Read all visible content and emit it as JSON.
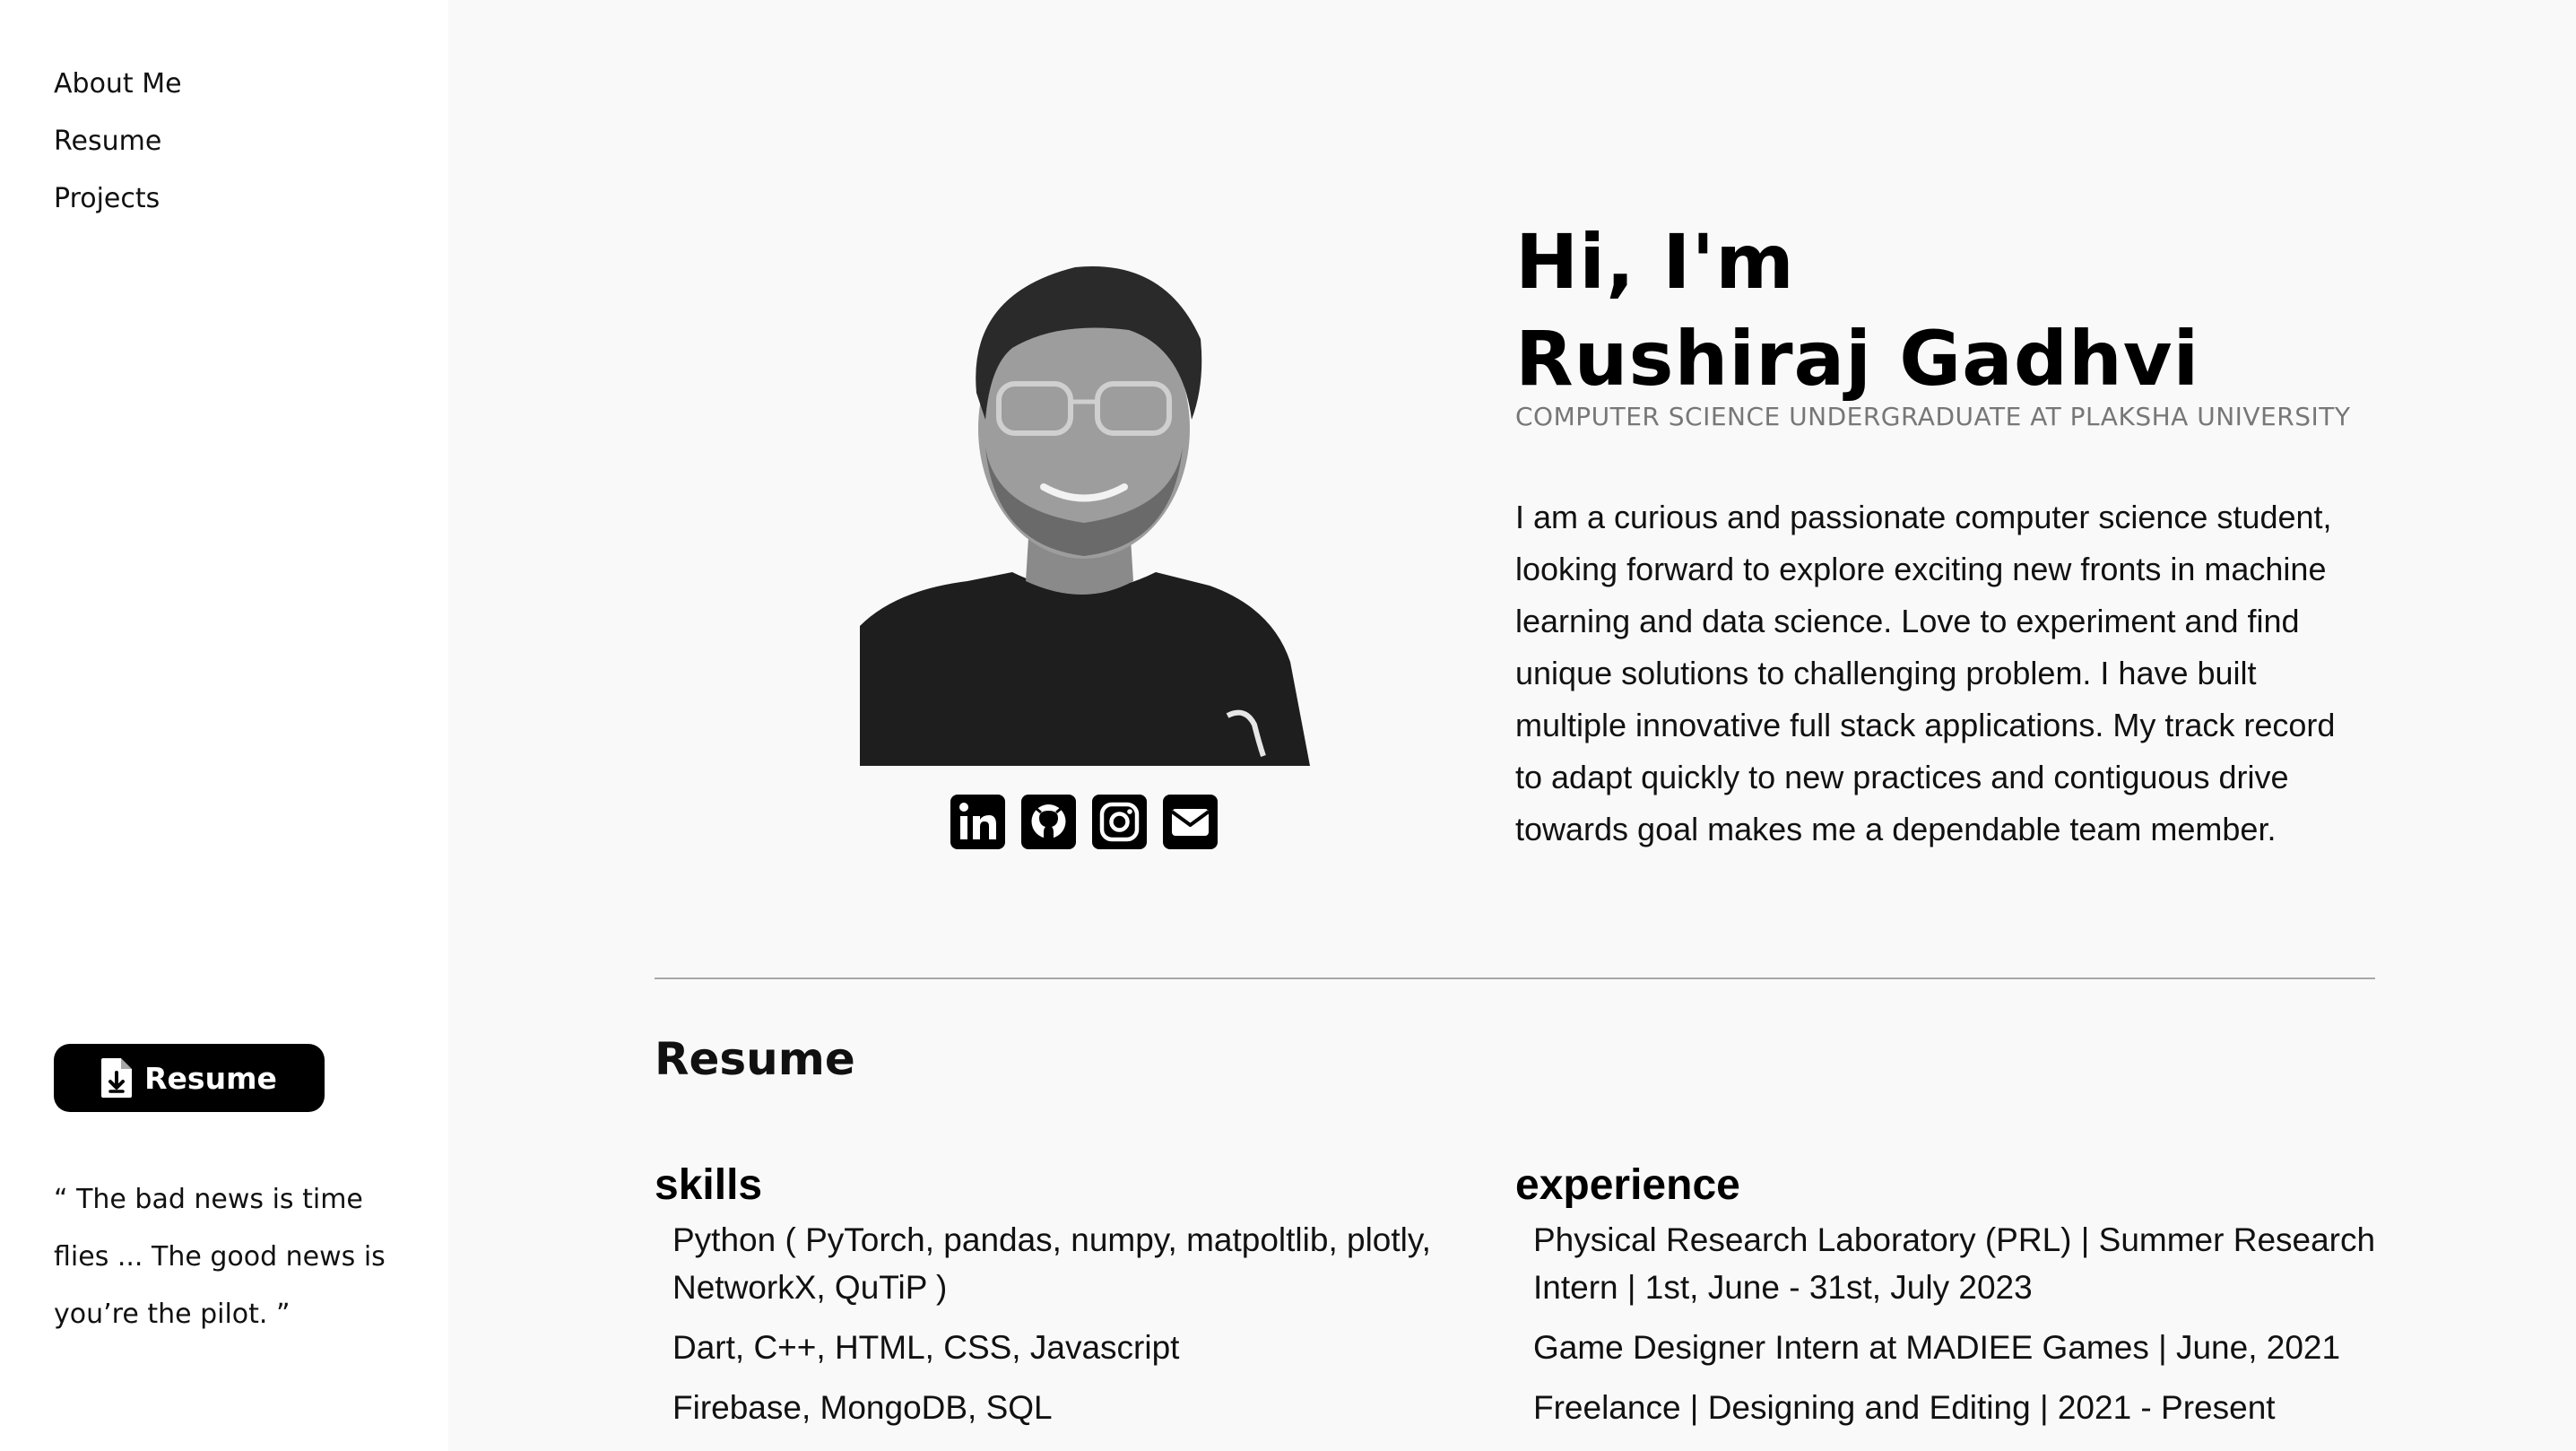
{
  "nav": {
    "items": [
      "About Me",
      "Resume",
      "Projects"
    ]
  },
  "sidebar": {
    "resume_button_label": "Resume",
    "quote": "“ The bad news is time flies ... The good news is you’re the pilot. ”"
  },
  "hero": {
    "greeting": "Hi, I'm",
    "name": "Rushiraj Gadhvi",
    "subtitle": "COMPUTER SCIENCE UNDERGRADUATE AT PLAKSHA UNIVERSITY",
    "bio": "I am a curious and passionate computer science student, looking forward to explore exciting new fronts in machine learning and data science. Love to experiment and find unique solutions to challenging problem. I have built multiple innovative full stack applications. My track record to adapt quickly to new practices and contiguous drive towards goal makes me a dependable team member."
  },
  "social_icons": [
    "linkedin-icon",
    "github-icon",
    "instagram-icon",
    "email-icon"
  ],
  "resume": {
    "title": "Resume",
    "skills": {
      "heading": "skills",
      "items": [
        "Python ( PyTorch, pandas, numpy, matpoltlib, plotly, NetworkX, QuTiP )",
        "Dart, C++, HTML, CSS, Javascript",
        "Firebase, MongoDB, SQL"
      ]
    },
    "experience": {
      "heading": "experience",
      "items": [
        "Physical Research Laboratory (PRL) | Summer Research Intern | 1st, June - 31st, July 2023",
        "Game Designer Intern at MADIEE Games | June, 2021",
        "Freelance | Designing and Editing | 2021 - Present"
      ]
    }
  },
  "colors": {
    "sidebar_bg": "#ffffff",
    "main_bg": "#f9f9f9",
    "button_bg": "#000000",
    "subtitle": "#777777",
    "divider": "#a8a8a8"
  }
}
